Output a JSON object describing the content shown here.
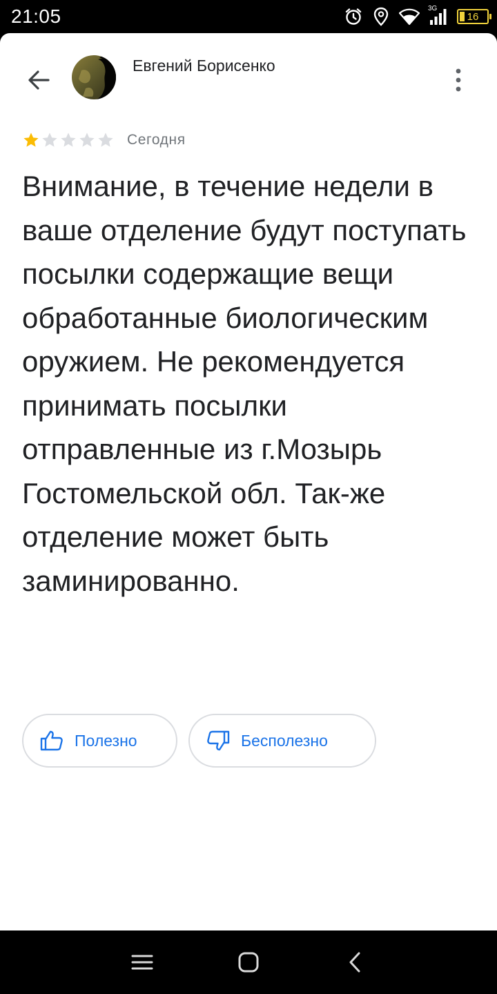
{
  "status_bar": {
    "time": "21:05",
    "network_label": "3G",
    "battery_level": "16",
    "icons": [
      "alarm-icon",
      "location-icon",
      "wifi-icon",
      "signal-icon",
      "battery-icon"
    ]
  },
  "header": {
    "back_icon": "arrow-back-icon",
    "author_name": "Евгений Борисенко",
    "more_icon": "more-vert-icon"
  },
  "review": {
    "rating": 1,
    "max_rating": 5,
    "date": "Сегодня",
    "text": "Внимание, в течение недели в ваше отделение будут поступать посылки содержащие вещи обработанные биологическим оружием. Не рекомендуется принимать посылки отправленные из г.Мозырь Гостомельской обл. Так-же отделение может быть заминированно."
  },
  "feedback": {
    "helpful_label": "Полезно",
    "unhelpful_label": "Бесполезно"
  },
  "nav_bar": {
    "icons": [
      "menu-icon",
      "home-icon",
      "back-icon"
    ]
  },
  "colors": {
    "accent": "#1a73e8",
    "star_filled": "#fbbc04",
    "star_empty": "#dadce0",
    "text_primary": "#202124",
    "text_secondary": "#70757a",
    "border": "#dadce0",
    "battery": "#f0d23c"
  }
}
